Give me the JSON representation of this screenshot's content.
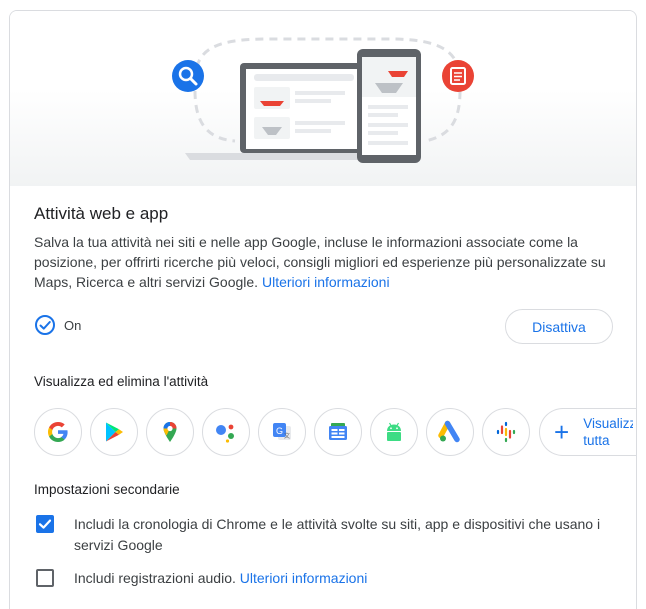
{
  "activity": {
    "title": "Attività web e app",
    "description": "Salva la tua attività nei siti e nelle app Google, incluse le informazioni associate come la posizione, per offrirti ricerche più veloci, consigli migliori ed esperienze più personalizzate su Maps, Ricerca e altri servizi Google.",
    "learn_more": "Ulteriori informazioni",
    "status": "On",
    "disable_label": "Disattiva"
  },
  "view_delete": {
    "heading": "Visualizza ed elimina l'attività",
    "apps": [
      {
        "name": "Google",
        "icon": "google-g-icon"
      },
      {
        "name": "Google Play",
        "icon": "google-play-icon"
      },
      {
        "name": "Google Maps",
        "icon": "google-maps-icon"
      },
      {
        "name": "Google Assistant",
        "icon": "google-assistant-icon"
      },
      {
        "name": "Google Traduttore",
        "icon": "google-translate-icon"
      },
      {
        "name": "Google News",
        "icon": "google-news-icon"
      },
      {
        "name": "Android",
        "icon": "android-icon"
      },
      {
        "name": "Google Ads",
        "icon": "google-ads-icon"
      },
      {
        "name": "Google Podcasts",
        "icon": "google-podcasts-icon"
      }
    ],
    "view_all_label": "Visualizza tutta"
  },
  "secondary": {
    "heading": "Impostazioni secondarie",
    "chrome_history": {
      "checked": true,
      "label": "Includi la cronologia di Chrome e le attività svolte su siti, app e dispositivi che usano i servizi Google"
    },
    "audio": {
      "checked": false,
      "label": "Includi registrazioni audio.",
      "learn_more": "Ulteriori informazioni"
    }
  },
  "colors": {
    "accent": "#1a73e8",
    "search_bubble": "#1a73e8",
    "doc_bubble": "#ea4335",
    "border": "#dadce0"
  }
}
